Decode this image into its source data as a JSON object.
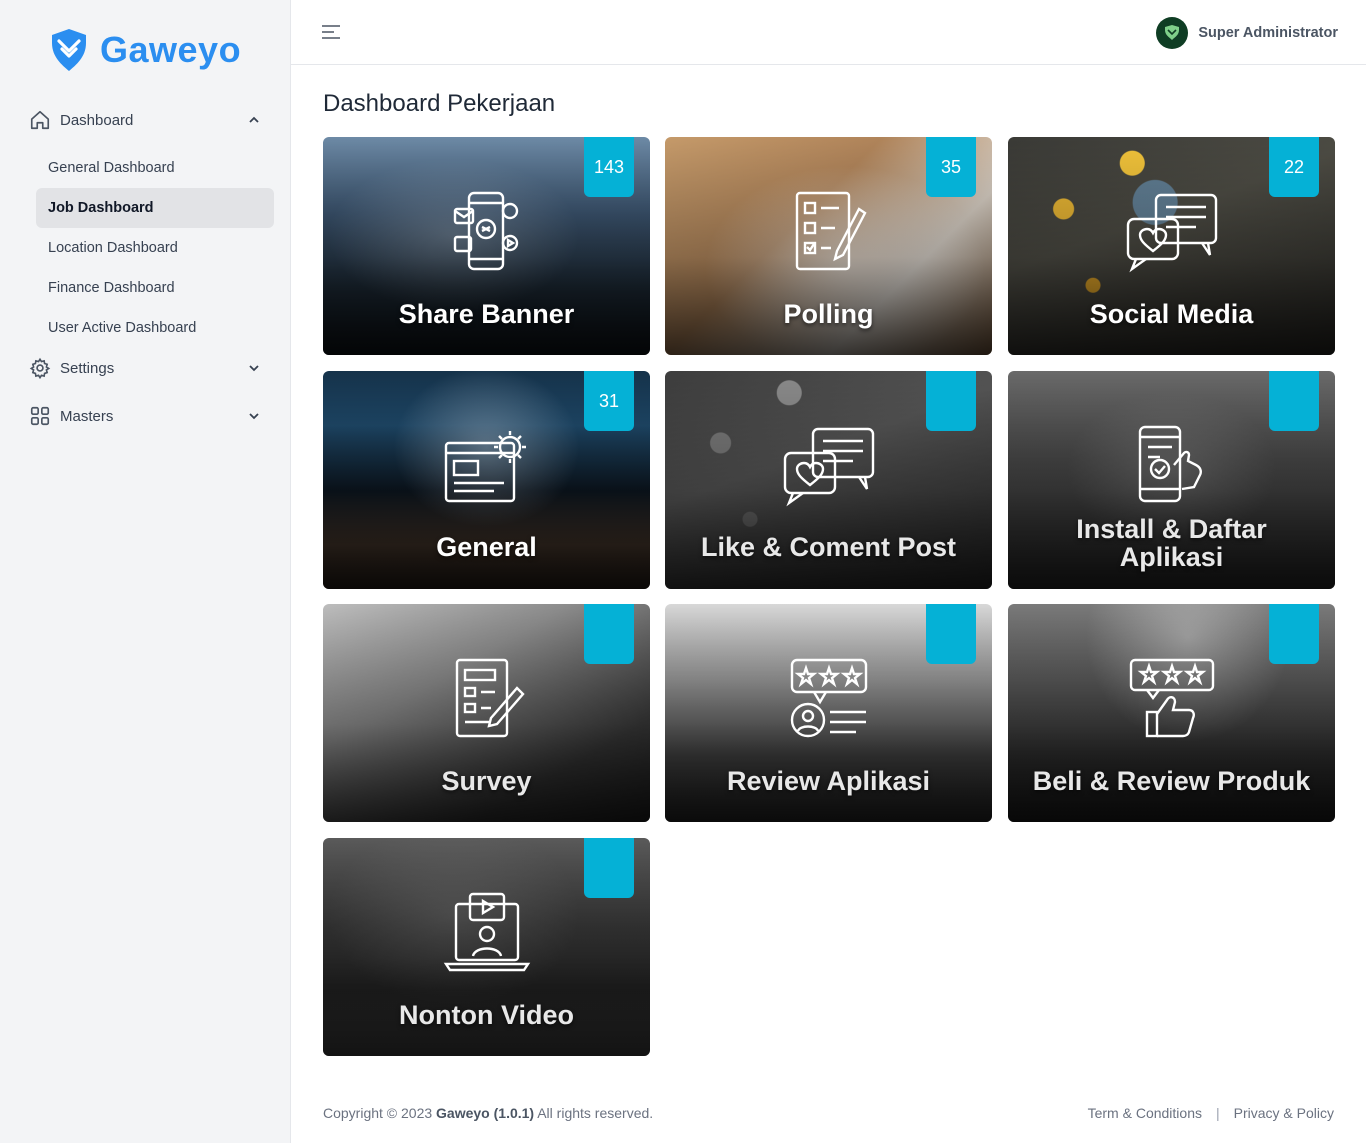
{
  "brand": {
    "name": "Gaweyo",
    "color": "#2b8ef0"
  },
  "sidebar": {
    "dashboard_label": "Dashboard",
    "dashboard_items": [
      {
        "label": "General Dashboard",
        "active": false
      },
      {
        "label": "Job Dashboard",
        "active": true
      },
      {
        "label": "Location Dashboard",
        "active": false
      },
      {
        "label": "Finance Dashboard",
        "active": false
      },
      {
        "label": "User Active Dashboard",
        "active": false
      }
    ],
    "settings_label": "Settings",
    "masters_label": "Masters"
  },
  "header": {
    "user_name": "Super Administrator"
  },
  "main": {
    "title": "Dashboard Pekerjaan",
    "badge_color": "#05b1d6",
    "cards": [
      {
        "label": "Share Banner",
        "count": "143",
        "icon": "phone-share-icon"
      },
      {
        "label": "Polling",
        "count": "35",
        "icon": "checklist-icon"
      },
      {
        "label": "Social Media",
        "count": "22",
        "icon": "chat-heart-icon"
      },
      {
        "label": "General",
        "count": "31",
        "icon": "browser-gear-icon"
      },
      {
        "label": "Like  & Coment Post",
        "count": "",
        "icon": "chat-heart-icon"
      },
      {
        "label": "Install & Daftar",
        "label2": "Aplikasi",
        "count": "",
        "icon": "phone-tap-icon"
      },
      {
        "label": "Survey",
        "count": "",
        "icon": "survey-form-icon"
      },
      {
        "label": "Review Aplikasi",
        "count": "",
        "icon": "rating-review-icon"
      },
      {
        "label": "Beli & Review Produk",
        "count": "",
        "icon": "thumbs-up-rating-icon"
      },
      {
        "label": "Nonton Video",
        "count": "",
        "icon": "laptop-video-icon"
      }
    ]
  },
  "footer": {
    "copyright_prefix": "Copyright © 2023",
    "app_version": "Gaweyo (1.0.1)",
    "rights": "All rights reserved.",
    "terms": "Term & Conditions",
    "privacy": "Privacy & Policy"
  }
}
